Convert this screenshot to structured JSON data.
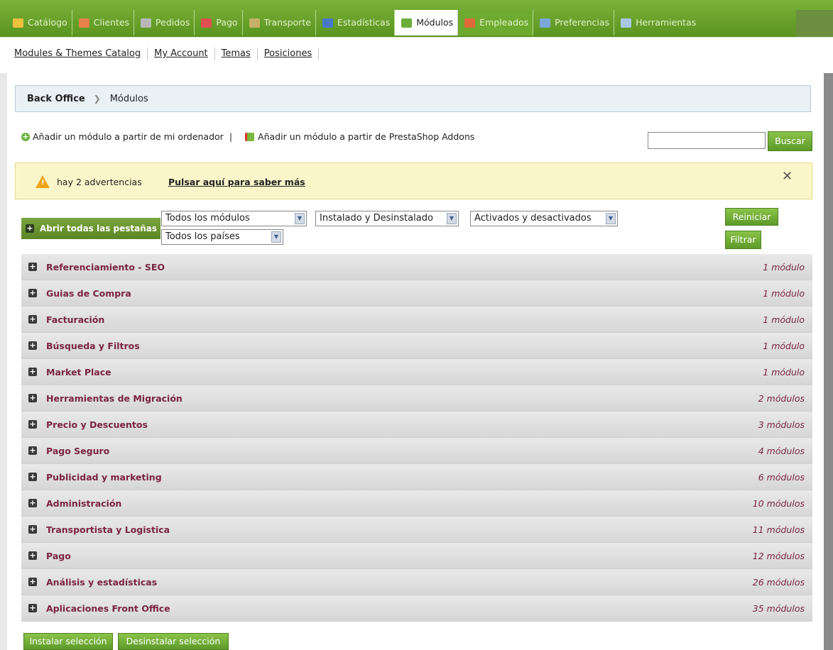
{
  "top_tabs": [
    {
      "label": "Catálogo",
      "icon": "folder-icon",
      "color": "#f0c040"
    },
    {
      "label": "Clientes",
      "icon": "user-icon",
      "color": "#e6824a"
    },
    {
      "label": "Pedidos",
      "icon": "cart-icon",
      "color": "#b8b8b8"
    },
    {
      "label": "Pago",
      "icon": "payment-icon",
      "color": "#e05050"
    },
    {
      "label": "Transporte",
      "icon": "truck-icon",
      "color": "#c8b068"
    },
    {
      "label": "Estadísticas",
      "icon": "chart-icon",
      "color": "#4a78c8"
    },
    {
      "label": "Módulos",
      "icon": "puzzle-icon",
      "color": "#6cae3a"
    },
    {
      "label": "Empleados",
      "icon": "employee-icon",
      "color": "#e06a3a"
    },
    {
      "label": "Preferencias",
      "icon": "preferences-icon",
      "color": "#7aa6d8"
    },
    {
      "label": "Herramientas",
      "icon": "wrench-icon",
      "color": "#a8c8e8"
    }
  ],
  "sub_menu": [
    "Modules & Themes Catalog",
    "My Account",
    "Temas",
    "Posiciones"
  ],
  "breadcrumb": {
    "root": "Back Office",
    "current": "Módulos"
  },
  "add_links": {
    "from_computer": "Añadir un módulo a partir de mi ordenador",
    "separator": "|",
    "from_addons": "Añadir un módulo a partir de PrestaShop Addons"
  },
  "search": {
    "value": "",
    "button": "Buscar"
  },
  "warning": {
    "count_text": "hay 2 advertencias",
    "link": "Pulsar aquí para saber más",
    "close": "✕"
  },
  "open_all_label": "Abrir todas las pestañas",
  "filters": {
    "modules": "Todos los módulos",
    "install_state": "Instalado y Desinstalado",
    "active_state": "Activados y desactivados",
    "country": "Todos los países",
    "reset": "Reiniciar",
    "filter": "Filtrar"
  },
  "categories": [
    {
      "name": "Referenciamiento - SEO",
      "count": "1 módulo"
    },
    {
      "name": "Guias de Compra",
      "count": "1 módulo"
    },
    {
      "name": "Facturación",
      "count": "1 módulo"
    },
    {
      "name": "Búsqueda y Filtros",
      "count": "1 módulo"
    },
    {
      "name": "Market Place",
      "count": "1 módulo"
    },
    {
      "name": "Herramientas de Migración",
      "count": "2 módulos"
    },
    {
      "name": "Precio y Descuentos",
      "count": "3 módulos"
    },
    {
      "name": "Pago Seguro",
      "count": "4 módulos"
    },
    {
      "name": "Publicidad y marketing",
      "count": "6 módulos"
    },
    {
      "name": "Administración",
      "count": "10 módulos"
    },
    {
      "name": "Transportista y Logistica",
      "count": "11 módulos"
    },
    {
      "name": "Pago",
      "count": "12 módulos"
    },
    {
      "name": "Análisis y estadísticas",
      "count": "26 módulos"
    },
    {
      "name": "Aplicaciones Front Office",
      "count": "35 módulos"
    }
  ],
  "actions": {
    "install": "Instalar selección",
    "uninstall": "Desinstalar selección"
  }
}
